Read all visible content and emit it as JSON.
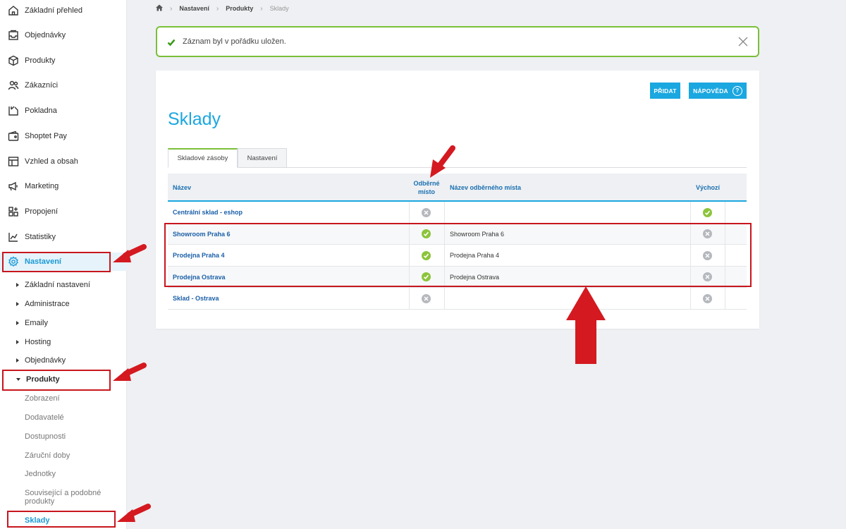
{
  "sidebar": {
    "items": [
      {
        "label": "Základní přehled",
        "icon": "home-icon"
      },
      {
        "label": "Objednávky",
        "icon": "inbox-icon"
      },
      {
        "label": "Produkty",
        "icon": "box-icon"
      },
      {
        "label": "Zákazníci",
        "icon": "users-icon"
      },
      {
        "label": "Pokladna",
        "icon": "register-icon"
      },
      {
        "label": "Shoptet Pay",
        "icon": "wallet-icon"
      },
      {
        "label": "Vzhled a obsah",
        "icon": "layout-icon"
      },
      {
        "label": "Marketing",
        "icon": "megaphone-icon"
      },
      {
        "label": "Propojení",
        "icon": "plugin-icon"
      },
      {
        "label": "Statistiky",
        "icon": "chart-icon"
      },
      {
        "label": "Nastavení",
        "icon": "gear-icon"
      }
    ],
    "settings_sub": [
      "Základní nastavení",
      "Administrace",
      "Emaily",
      "Hosting",
      "Objednávky",
      "Produkty"
    ],
    "product_sub": [
      "Zobrazení",
      "Dodavatelé",
      "Dostupnosti",
      "Záruční doby",
      "Jednotky",
      "Související a podobné produkty",
      "Sklady"
    ]
  },
  "breadcrumb": [
    "Nastavení",
    "Produkty",
    "Sklady"
  ],
  "alert": {
    "message": "Záznam byl v pořádku uložen."
  },
  "buttons": {
    "add": "PŘIDAT",
    "help": "NÁPOVĚDA",
    "help_icon": "?"
  },
  "page_title": "Sklady",
  "tabs": [
    "Skladové zásoby",
    "Nastavení"
  ],
  "table": {
    "headers": {
      "name": "Název",
      "pickup": "Odběrné místo",
      "pickup_name": "Název odběrného místa",
      "default": "Výchozí"
    },
    "rows": [
      {
        "name": "Centrální sklad - eshop",
        "pickup": false,
        "pickup_name": "",
        "default": true
      },
      {
        "name": "Showroom Praha 6",
        "pickup": true,
        "pickup_name": "Showroom Praha 6",
        "default": false
      },
      {
        "name": "Prodejna Praha 4",
        "pickup": true,
        "pickup_name": "Prodejna Praha 4",
        "default": false
      },
      {
        "name": "Prodejna Ostrava",
        "pickup": true,
        "pickup_name": "Prodejna Ostrava",
        "default": false
      },
      {
        "name": "Sklad - Ostrava",
        "pickup": false,
        "pickup_name": "",
        "default": false
      }
    ]
  },
  "colors": {
    "accent": "#1ba7e0",
    "success": "#8cc43c",
    "annotation": "#c8161d"
  }
}
